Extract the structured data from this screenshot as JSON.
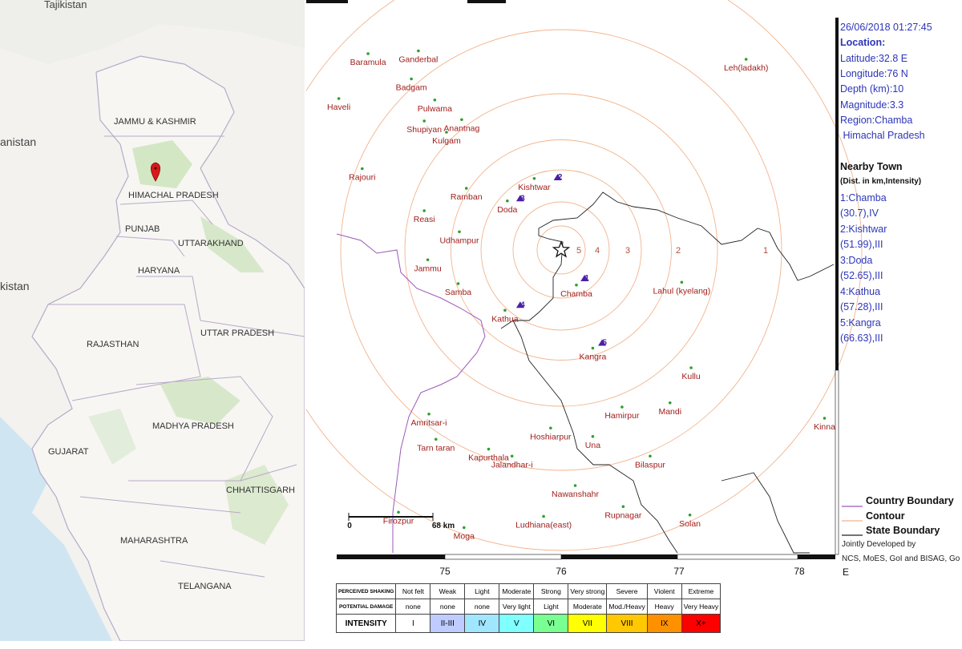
{
  "india_map": {
    "neighbors": [
      "Tajikistan",
      "anistan",
      "kistan"
    ],
    "states": [
      "JAMMU & KASHMIR",
      "HIMACHAL PRADESH",
      "PUNJAB",
      "UTTARAKHAND",
      "HARYANA",
      "UTTAR PRADESH",
      "RAJASTHAN",
      "MADHYA PRADESH",
      "GUJARAT",
      "CHHATTISGARH",
      "MAHARASHTRA",
      "TELANGANA"
    ],
    "marker": "epicenter-pin",
    "colors": {
      "land": "#f3f2ef",
      "border": "#b8a9c8",
      "green": "#c9e3b8",
      "water": "#cfe6f2",
      "marker": "#d7191c"
    }
  },
  "eq_map": {
    "towns": [
      {
        "name": "Baramula",
        "lon": 74.35,
        "lat": 34.2
      },
      {
        "name": "Ganderbal",
        "lon": 74.78,
        "lat": 34.22
      },
      {
        "name": "Leh(ladakh)",
        "lon": 77.58,
        "lat": 34.16
      },
      {
        "name": "Haveli",
        "lon": 74.1,
        "lat": 33.88
      },
      {
        "name": "Badgam",
        "lon": 74.72,
        "lat": 34.02
      },
      {
        "name": "Pulwama",
        "lon": 74.92,
        "lat": 33.87
      },
      {
        "name": "Shupiyan",
        "lon": 74.83,
        "lat": 33.72
      },
      {
        "name": "Anantnag",
        "lon": 75.15,
        "lat": 33.73
      },
      {
        "name": "Kulgam",
        "lon": 75.02,
        "lat": 33.64
      },
      {
        "name": "Rajouri",
        "lon": 74.3,
        "lat": 33.38
      },
      {
        "name": "Ramban",
        "lon": 75.19,
        "lat": 33.24
      },
      {
        "name": "Kishtwar",
        "lon": 75.77,
        "lat": 33.31
      },
      {
        "name": "Doda",
        "lon": 75.54,
        "lat": 33.15
      },
      {
        "name": "Reasi",
        "lon": 74.83,
        "lat": 33.08
      },
      {
        "name": "Udhampur",
        "lon": 75.13,
        "lat": 32.93
      },
      {
        "name": "Jammu",
        "lon": 74.86,
        "lat": 32.73
      },
      {
        "name": "Samba",
        "lon": 75.12,
        "lat": 32.56
      },
      {
        "name": "Chamba",
        "lon": 76.13,
        "lat": 32.55
      },
      {
        "name": "Lahul (kyelang)",
        "lon": 77.03,
        "lat": 32.57
      },
      {
        "name": "Kathua",
        "lon": 75.52,
        "lat": 32.37
      },
      {
        "name": "Kangra",
        "lon": 76.27,
        "lat": 32.1
      },
      {
        "name": "Kullu",
        "lon": 77.11,
        "lat": 31.96
      },
      {
        "name": "Amritsar-i",
        "lon": 74.87,
        "lat": 31.63
      },
      {
        "name": "Hoshiarpur",
        "lon": 75.91,
        "lat": 31.53
      },
      {
        "name": "Hamirpur",
        "lon": 76.52,
        "lat": 31.68
      },
      {
        "name": "Mandi",
        "lon": 76.93,
        "lat": 31.71
      },
      {
        "name": "Una",
        "lon": 76.27,
        "lat": 31.47
      },
      {
        "name": "Tarn taran",
        "lon": 74.93,
        "lat": 31.45
      },
      {
        "name": "Kapurthala",
        "lon": 75.38,
        "lat": 31.38
      },
      {
        "name": "Jalandhar-i",
        "lon": 75.58,
        "lat": 31.33
      },
      {
        "name": "Bilaspur",
        "lon": 76.76,
        "lat": 31.33
      },
      {
        "name": "Kinna",
        "lon": 78.25,
        "lat": 31.6
      },
      {
        "name": "Nawanshahr",
        "lon": 76.12,
        "lat": 31.12
      },
      {
        "name": "Firozpur",
        "lon": 74.61,
        "lat": 30.93
      },
      {
        "name": "Rupnagar",
        "lon": 76.53,
        "lat": 30.97
      },
      {
        "name": "Moga",
        "lon": 75.17,
        "lat": 30.82
      },
      {
        "name": "Ludhiana(east)",
        "lon": 75.85,
        "lat": 30.9
      },
      {
        "name": "Solan",
        "lon": 77.1,
        "lat": 30.91
      }
    ],
    "nearby_markers": [
      {
        "num": "1",
        "lon": 76.2,
        "lat": 32.6
      },
      {
        "num": "2",
        "lon": 75.97,
        "lat": 33.32
      },
      {
        "num": "3",
        "lon": 75.65,
        "lat": 33.17
      },
      {
        "num": "4",
        "lon": 75.65,
        "lat": 32.41
      },
      {
        "num": "5",
        "lon": 76.35,
        "lat": 32.14
      }
    ],
    "epicenter": {
      "lon": 76.0,
      "lat": 32.8
    },
    "contour_labels": [
      "5",
      "4",
      "3",
      "2",
      "1"
    ],
    "contour_radii_km": [
      12,
      24,
      40,
      55,
      78,
      110,
      150
    ],
    "scale_bar": {
      "start": "0",
      "end": "68 km"
    },
    "lon_ticks": [
      "75",
      "76",
      "77",
      "78"
    ],
    "east_label": "E",
    "colors": {
      "contour": "#f2b48e",
      "country": "#9b59b6",
      "state": "#222222",
      "town_dot": "#2ca02c",
      "town_label": "#a0201d",
      "marker": "#4b1fa8"
    }
  },
  "info": {
    "datetime": "26/06/2018 01:27:45",
    "location_label": "Location:",
    "latitude": "Latitude:32.8 E",
    "longitude": "Longitude:76 N",
    "depth": "Depth (km):10",
    "magnitude": "Magnitude:3.3",
    "region_1": "Region:Chamba",
    "region_2": " Himachal Pradesh",
    "nearby_title": "Nearby Town",
    "nearby_sub": "(Dist. in km,Intensity)",
    "nearby": [
      {
        "name": "1:Chamba",
        "detail": "(30.7),IV"
      },
      {
        "name": "2:Kishtwar",
        "detail": "(51.99),III"
      },
      {
        "name": "3:Doda",
        "detail": "(52.65),III"
      },
      {
        "name": "4:Kathua",
        "detail": "(57.28),III"
      },
      {
        "name": "5:Kangra",
        "detail": "(66.63),III"
      }
    ]
  },
  "legend": {
    "country": "Country Boundary",
    "contour": "Contour",
    "state": "State Boundary",
    "credit_1": "Jointly Developed by",
    "credit_2": "NCS, MoES, GoI and BISAG, Go"
  },
  "intensity_scale": {
    "row_labels": {
      "shaking": "PERCEIVED SHAKING",
      "damage": "POTENTIAL DAMAGE",
      "intensity": "INTENSITY"
    },
    "columns": [
      {
        "shaking": "Not felt",
        "damage": "none",
        "intensity": "I",
        "color": "#ffffff"
      },
      {
        "shaking": "Weak",
        "damage": "none",
        "intensity": "II-III",
        "color": "#bfccff"
      },
      {
        "shaking": "Light",
        "damage": "none",
        "intensity": "IV",
        "color": "#a0e6ff"
      },
      {
        "shaking": "Moderate",
        "damage": "Very light",
        "intensity": "V",
        "color": "#80ffff"
      },
      {
        "shaking": "Strong",
        "damage": "Light",
        "intensity": "VI",
        "color": "#7aff93"
      },
      {
        "shaking": "Very strong",
        "damage": "Moderate",
        "intensity": "VII",
        "color": "#ffff00"
      },
      {
        "shaking": "Severe",
        "damage": "Mod./Heavy",
        "intensity": "VIII",
        "color": "#ffc800"
      },
      {
        "shaking": "Violent",
        "damage": "Heavy",
        "intensity": "IX",
        "color": "#ff9100"
      },
      {
        "shaking": "Extreme",
        "damage": "Very Heavy",
        "intensity": "X+",
        "color": "#ff0000"
      }
    ]
  }
}
